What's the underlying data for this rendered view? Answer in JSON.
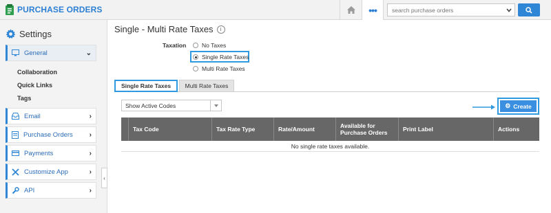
{
  "app": {
    "title": "PURCHASE ORDERS",
    "brand_color": "#2b7fd4"
  },
  "header": {
    "search_placeholder": "search purchase orders",
    "menu_dots": "•••",
    "icons": [
      "app-logo-icon",
      "home-icon",
      "more-dots-icon",
      "chevron-down-icon",
      "search-icon"
    ]
  },
  "sidebar": {
    "title": "Settings",
    "items": [
      {
        "label": "General",
        "icon": "monitor-icon",
        "expanded": true
      },
      {
        "label": "Email",
        "icon": "inbox-icon"
      },
      {
        "label": "Purchase Orders",
        "icon": "document-icon"
      },
      {
        "label": "Payments",
        "icon": "credit-card-icon"
      },
      {
        "label": "Customize App",
        "icon": "tools-icon"
      },
      {
        "label": "API",
        "icon": "wrench-icon"
      }
    ],
    "sub_items": [
      "Collaboration",
      "Quick Links",
      "Tags"
    ],
    "collapse_glyph": "‹"
  },
  "main": {
    "title": "Single - Multi Rate Taxes",
    "taxation_label": "Taxation",
    "taxation_options": [
      {
        "label": "No Taxes",
        "selected": false
      },
      {
        "label": "Single Rate Taxes",
        "selected": true
      },
      {
        "label": "Multi Rate Taxes",
        "selected": false
      }
    ],
    "tabs": [
      {
        "label": "Single Rate Taxes",
        "active": true
      },
      {
        "label": "Multi Rate Taxes",
        "active": false
      }
    ],
    "filter_value": "Show Active Codes",
    "create_label": "Create",
    "table": {
      "columns": [
        "Tax Code",
        "Tax Rate Type",
        "Rate/Amount",
        "Available for Purchase Orders",
        "Print Label",
        "Actions"
      ],
      "empty_message": "No single rate taxes available."
    }
  },
  "colors": {
    "accent": "#2f86d6",
    "highlight": "#2f9ae0",
    "table_header": "#676767"
  }
}
